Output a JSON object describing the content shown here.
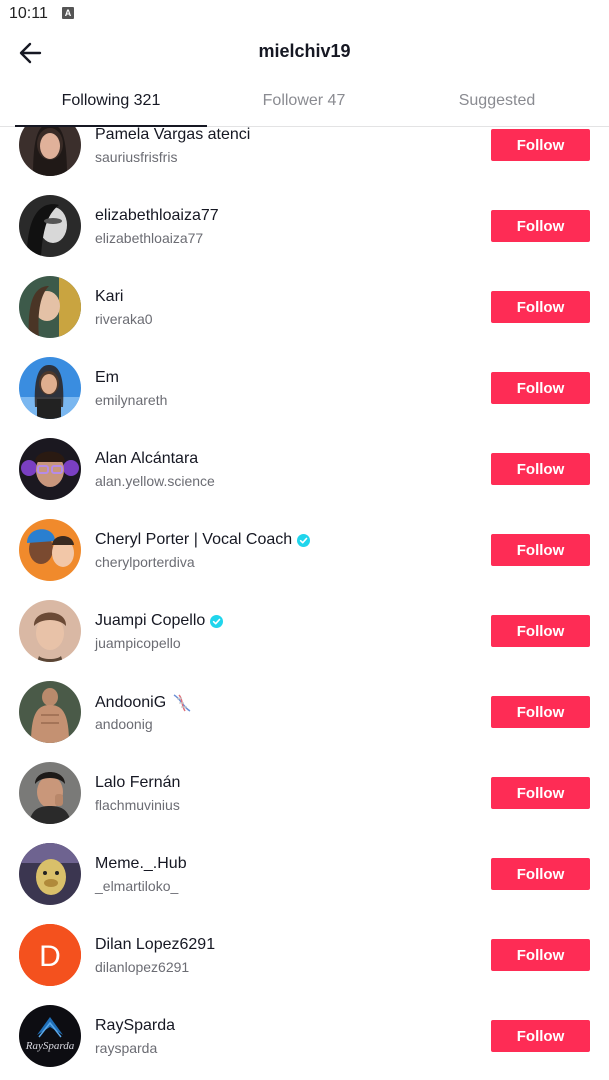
{
  "status": {
    "time": "10:11",
    "indicator": "A"
  },
  "header": {
    "title": "mielchiv19",
    "back_icon": "arrow-left-icon"
  },
  "tabs": [
    {
      "label": "Following 321",
      "active": true
    },
    {
      "label": "Follower 47",
      "active": false
    },
    {
      "label": "Suggested",
      "active": false
    }
  ],
  "colors": {
    "accent": "#fe2c55",
    "verified": "#20d5ec",
    "text": "#161823",
    "subtext": "#6b6c73"
  },
  "users": [
    {
      "name": "Pamela Vargas atenci",
      "handle": "sauriusfrisfris",
      "verified": false,
      "button": "Follow"
    },
    {
      "name": "elizabethloaiza77",
      "handle": "elizabethloaiza77",
      "verified": false,
      "button": "Follow"
    },
    {
      "name": "Kari",
      "handle": "riveraka0",
      "verified": false,
      "button": "Follow"
    },
    {
      "name": "Em",
      "handle": "emilynareth",
      "verified": false,
      "button": "Follow"
    },
    {
      "name": "Alan Alcántara",
      "handle": "alan.yellow.science",
      "verified": false,
      "button": "Follow"
    },
    {
      "name": "Cheryl Porter | Vocal Coach",
      "handle": "cherylporterdiva",
      "verified": true,
      "button": "Follow"
    },
    {
      "name": "Juampi Copello",
      "handle": "juampicopello",
      "verified": true,
      "button": "Follow"
    },
    {
      "name": "AndooniG",
      "handle": "andoonig",
      "verified": false,
      "button": "Follow"
    },
    {
      "name": "Lalo Fernán",
      "handle": "flachmuvinius",
      "verified": false,
      "button": "Follow"
    },
    {
      "name": "Meme._.Hub",
      "handle": "_elmartiloko_",
      "verified": false,
      "button": "Follow"
    },
    {
      "name": "Dilan Lopez6291",
      "handle": "dilanlopez6291",
      "verified": false,
      "button": "Follow",
      "avatar_letter": "D"
    },
    {
      "name": "RaySparda",
      "handle": "raysparda",
      "verified": false,
      "button": "Follow",
      "avatar_text": "RaySparda"
    }
  ]
}
